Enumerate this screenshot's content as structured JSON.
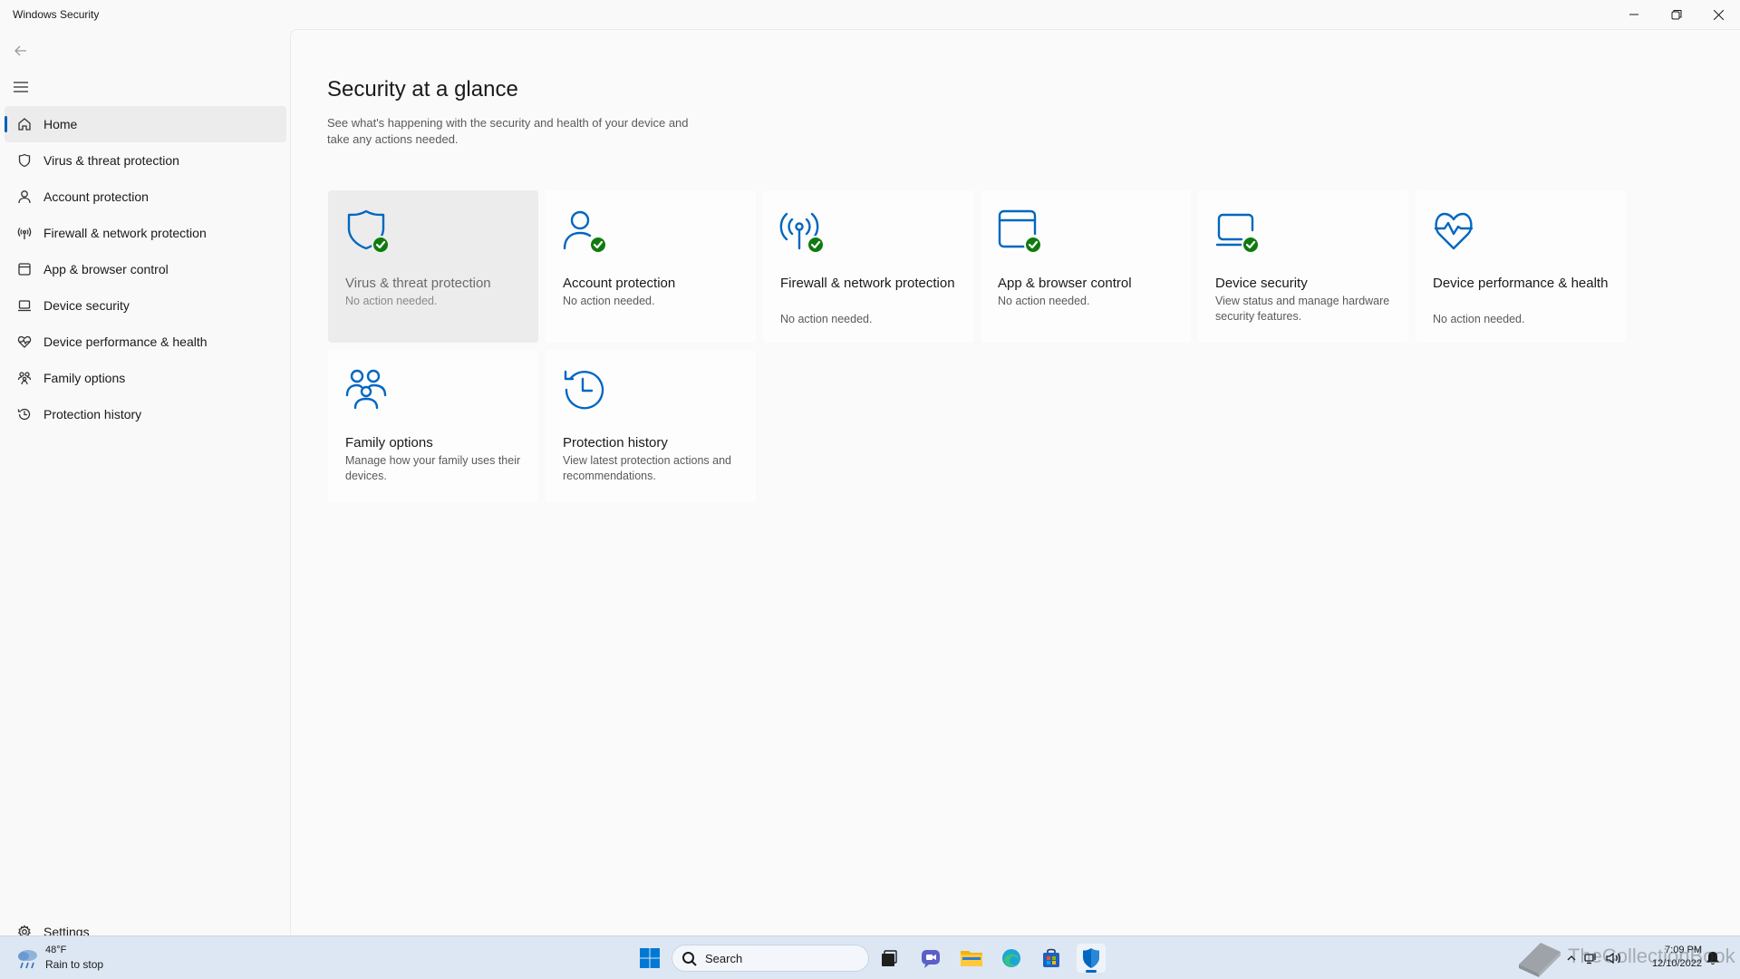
{
  "window": {
    "title": "Windows Security",
    "controls": {
      "minimize": "minimize-icon",
      "restore": "restore-icon",
      "close": "close-icon"
    }
  },
  "sidebar": {
    "back_icon": "back-arrow-icon",
    "menu_icon": "hamburger-menu-icon",
    "items": [
      {
        "label": "Home",
        "icon": "home-icon",
        "active": true
      },
      {
        "label": "Virus & threat protection",
        "icon": "shield-icon"
      },
      {
        "label": "Account protection",
        "icon": "person-icon"
      },
      {
        "label": "Firewall & network protection",
        "icon": "antenna-icon"
      },
      {
        "label": "App & browser control",
        "icon": "app-window-icon"
      },
      {
        "label": "Device security",
        "icon": "laptop-icon"
      },
      {
        "label": "Device performance & health",
        "icon": "heartbeat-icon"
      },
      {
        "label": "Family options",
        "icon": "family-icon"
      },
      {
        "label": "Protection history",
        "icon": "history-icon"
      }
    ],
    "settings": {
      "label": "Settings",
      "icon": "gear-icon"
    }
  },
  "main": {
    "title": "Security at a glance",
    "subtitle": "See what's happening with the security and health of your device and take any actions needed.",
    "tiles": [
      {
        "title": "Virus & threat protection",
        "status": "No action needed.",
        "icon": "shield-icon",
        "check": true,
        "hover": true
      },
      {
        "title": "Account protection",
        "status": "No action needed.",
        "icon": "person-icon",
        "check": true
      },
      {
        "title": "Firewall & network protection",
        "status": "No action needed.",
        "icon": "antenna-icon",
        "check": true
      },
      {
        "title": "App & browser control",
        "status": "No action needed.",
        "icon": "app-window-icon",
        "check": true
      },
      {
        "title": "Device security",
        "status": "View status and manage hardware security features.",
        "icon": "laptop-icon",
        "check": true
      },
      {
        "title": "Device performance & health",
        "status": "No action needed.",
        "icon": "heartbeat-icon",
        "check": false
      },
      {
        "title": "Family options",
        "status": "Manage how your family uses their devices.",
        "icon": "family-icon",
        "check": false
      },
      {
        "title": "Protection history",
        "status": "View latest protection actions and recommendations.",
        "icon": "history-icon",
        "check": false
      }
    ],
    "accent_color": "#0067c0",
    "ok_color": "#0f7b0f"
  },
  "taskbar": {
    "weather": {
      "temp": "48°F",
      "condition": "Rain to stop",
      "icon": "rain-cloud-icon"
    },
    "search": {
      "placeholder": "Search",
      "icon": "search-icon"
    },
    "apps": [
      {
        "name": "start-button",
        "icon": "windows-logo-icon"
      },
      {
        "name": "task-view",
        "icon": "task-view-icon"
      },
      {
        "name": "chat",
        "icon": "chat-icon"
      },
      {
        "name": "file-explorer",
        "icon": "folder-icon"
      },
      {
        "name": "edge",
        "icon": "edge-icon"
      },
      {
        "name": "store",
        "icon": "store-icon"
      },
      {
        "name": "windows-security",
        "icon": "shield-icon",
        "active": true
      }
    ],
    "tray": {
      "chevron": "chevron-up-icon",
      "network": "network-icon",
      "volume": "speaker-icon",
      "notifications": "bell-icon"
    },
    "time": "7:09 PM",
    "date": "12/10/2022"
  },
  "watermark": {
    "text": "TheCollectionBook"
  }
}
